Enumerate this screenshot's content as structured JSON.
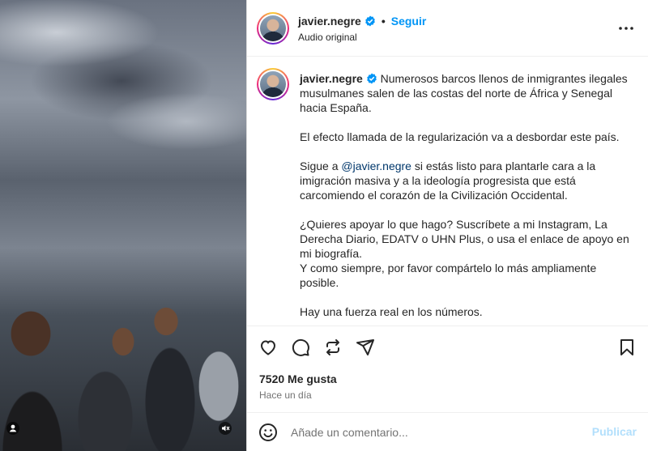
{
  "post": {
    "username": "javier.negre",
    "follow_label": "Seguir",
    "separator": "•",
    "subtitle": "Audio original",
    "caption": {
      "p1": "Numerosos barcos llenos de inmigrantes ilegales musulmanes salen de las costas del norte de África y Senegal hacia España.",
      "p2": "El efecto llamada de la regularización va a desbordar este país.",
      "p3_before": "Sigue a ",
      "p3_mention": "@javier.negre",
      "p3_after": " si estás listo para plantarle cara a la imigración masiva y a la ideología progresista que está carcomiendo el corazón de la Civilización Occidental.",
      "p4": "¿Quieres apoyar lo que hago? Suscríbete a mi Instagram, La Derecha Diario, EDATV o UHN Plus, o usa el enlace de apoyo en mi biografía.",
      "p5": "Y como siempre, por favor compártelo lo más ampliamente posible.",
      "p6": "Hay una fuerza real en los números."
    },
    "likes_label": "7520 Me gusta",
    "time_label": "Hace un día"
  },
  "comment": {
    "placeholder": "Añade un comentario...",
    "publish_label": "Publicar"
  },
  "icons": {
    "like": "heart-icon",
    "comment": "comment-icon",
    "share": "repost-icon",
    "send": "send-icon",
    "save": "bookmark-icon",
    "more": "more-horizontal-icon",
    "emoji": "emoji-icon",
    "mute": "muted-speaker-icon",
    "tagged": "user-tag-icon"
  },
  "colors": {
    "accent": "#0095f6",
    "mention": "#00376b",
    "publish_disabled": "#b2dffc",
    "muted_text": "#737373"
  }
}
